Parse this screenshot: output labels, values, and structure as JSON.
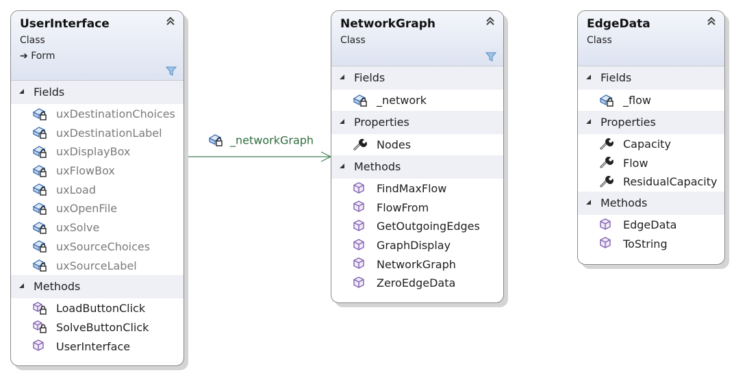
{
  "diagram": {
    "type": "class-diagram",
    "classes": [
      {
        "name": "UserInterface",
        "kind": "Class",
        "base": "Form",
        "sections": {
          "fields": {
            "label": "Fields",
            "items": [
              {
                "name": "uxDestinationChoices",
                "icon": "private-field-icon",
                "dim": true
              },
              {
                "name": "uxDestinationLabel",
                "icon": "private-field-icon",
                "dim": true
              },
              {
                "name": "uxDisplayBox",
                "icon": "private-field-icon",
                "dim": true
              },
              {
                "name": "uxFlowBox",
                "icon": "private-field-icon",
                "dim": true
              },
              {
                "name": "uxLoad",
                "icon": "private-field-icon",
                "dim": true
              },
              {
                "name": "uxOpenFile",
                "icon": "private-field-icon",
                "dim": true
              },
              {
                "name": "uxSolve",
                "icon": "private-field-icon",
                "dim": true
              },
              {
                "name": "uxSourceChoices",
                "icon": "private-field-icon",
                "dim": true
              },
              {
                "name": "uxSourceLabel",
                "icon": "private-field-icon",
                "dim": true
              }
            ]
          },
          "methods": {
            "label": "Methods",
            "items": [
              {
                "name": "LoadButtonClick",
                "icon": "private-method-icon"
              },
              {
                "name": "SolveButtonClick",
                "icon": "private-method-icon"
              },
              {
                "name": "UserInterface",
                "icon": "public-method-icon"
              }
            ]
          }
        }
      },
      {
        "name": "NetworkGraph",
        "kind": "Class",
        "sections": {
          "fields": {
            "label": "Fields",
            "items": [
              {
                "name": "_network",
                "icon": "private-field-icon"
              }
            ]
          },
          "properties": {
            "label": "Properties",
            "items": [
              {
                "name": "Nodes",
                "icon": "property-wrench-icon"
              }
            ]
          },
          "methods": {
            "label": "Methods",
            "items": [
              {
                "name": "FindMaxFlow",
                "icon": "public-method-icon"
              },
              {
                "name": "FlowFrom",
                "icon": "public-method-icon"
              },
              {
                "name": "GetOutgoingEdges",
                "icon": "public-method-icon"
              },
              {
                "name": "GraphDisplay",
                "icon": "public-method-icon"
              },
              {
                "name": "NetworkGraph",
                "icon": "public-method-icon"
              },
              {
                "name": "ZeroEdgeData",
                "icon": "public-method-icon"
              }
            ]
          }
        }
      },
      {
        "name": "EdgeData",
        "kind": "Class",
        "sections": {
          "fields": {
            "label": "Fields",
            "items": [
              {
                "name": "_flow",
                "icon": "private-field-icon"
              }
            ]
          },
          "properties": {
            "label": "Properties",
            "items": [
              {
                "name": "Capacity",
                "icon": "property-wrench-icon"
              },
              {
                "name": "Flow",
                "icon": "property-wrench-icon"
              },
              {
                "name": "ResidualCapacity",
                "icon": "property-wrench-icon"
              }
            ]
          },
          "methods": {
            "label": "Methods",
            "items": [
              {
                "name": "EdgeData",
                "icon": "public-method-icon"
              },
              {
                "name": "ToString",
                "icon": "public-method-icon"
              }
            ]
          }
        }
      }
    ],
    "associations": [
      {
        "from": "UserInterface",
        "to": "NetworkGraph",
        "label": "_networkGraph",
        "icon": "private-field-icon"
      }
    ],
    "colors": {
      "association_line": "#3f7d4f",
      "association_text": "#2d6b3c",
      "method_icon": "#8060b0",
      "field_icon": "#3a6fb0",
      "dim_text": "#7a7a7a"
    }
  }
}
